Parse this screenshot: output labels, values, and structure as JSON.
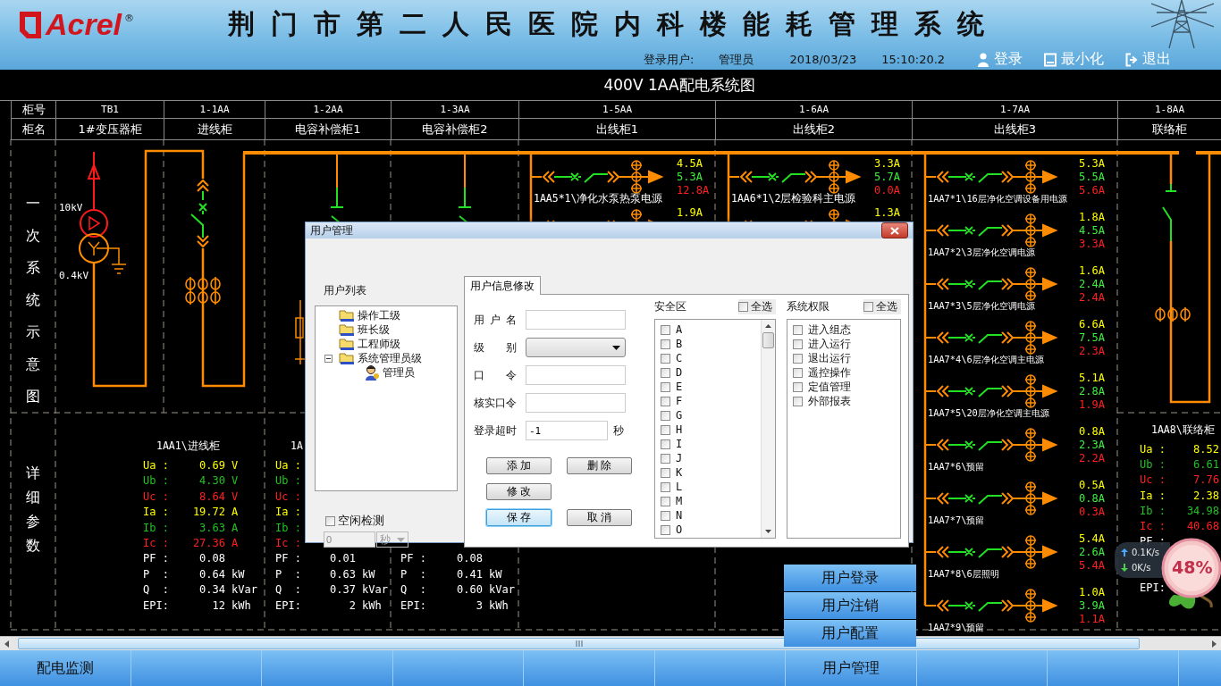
{
  "header": {
    "logo": "Acrel",
    "logo_mark": "®",
    "title": "荆门市第二人民医院内科楼能耗管理系统",
    "login_label": "登录用户:",
    "user": "管理员",
    "date": "2018/03/23",
    "time": "15:10:20.2",
    "actions": [
      {
        "label": "登录"
      },
      {
        "label": "最小化"
      },
      {
        "label": "退出"
      }
    ]
  },
  "diagram_title": "400V 1AA配电系统图",
  "cabinet_table": {
    "number_label": "柜号",
    "name_label": "柜名",
    "cabinets": [
      {
        "number": "TB1",
        "name": "1#变压器柜"
      },
      {
        "number": "1-1AA",
        "name": "进线柜"
      },
      {
        "number": "1-2AA",
        "name": "电容补偿柜1"
      },
      {
        "number": "1-3AA",
        "name": "电容补偿柜2"
      },
      {
        "number": "1-5AA",
        "name": "出线柜1"
      },
      {
        "number": "1-6AA",
        "name": "出线柜2"
      },
      {
        "number": "1-7AA",
        "name": "出线柜3"
      },
      {
        "number": "1-8AA",
        "name": "联络柜"
      }
    ]
  },
  "section_labels": [
    "一次系统示意图",
    "详细参数"
  ],
  "diagram": {
    "voltage_high": "10kV",
    "voltage_low": "0.4kV",
    "feeder_groups": [
      {
        "feeders": [
          {
            "name": "1AA5*1\\净化水泵热泵电源",
            "currents": [
              {
                "value": "4.5A",
                "color": "#ffff00"
              },
              {
                "value": "5.3A",
                "color": "#3cf03c"
              },
              {
                "value": "12.8A",
                "color": "#ff2020"
              }
            ]
          },
          {
            "currents": [
              {
                "value": "1.9A",
                "color": "#ffff00"
              }
            ]
          }
        ]
      },
      {
        "feeders": [
          {
            "name": "1AA6*1\\2层检验科主电源",
            "currents": [
              {
                "value": "3.3A",
                "color": "#ffff00"
              },
              {
                "value": "5.7A",
                "color": "#3cf03c"
              },
              {
                "value": "0.0A",
                "color": "#ff2020"
              }
            ]
          },
          {
            "currents": [
              {
                "value": "1.3A",
                "color": "#ffff00"
              }
            ]
          }
        ]
      },
      {
        "feeders": [
          {
            "name": "1AA7*1\\16层净化空调设备用电源",
            "currents": [
              {
                "value": "5.3A",
                "color": "#ffff00"
              },
              {
                "value": "5.5A",
                "color": "#3cf03c"
              },
              {
                "value": "5.6A",
                "color": "#ff2020"
              }
            ]
          },
          {
            "name": "1AA7*2\\3层净化空调电源",
            "currents": [
              {
                "value": "1.8A",
                "color": "#ffff00"
              },
              {
                "value": "4.5A",
                "color": "#3cf03c"
              },
              {
                "value": "3.3A",
                "color": "#ff2020"
              }
            ]
          },
          {
            "name": "1AA7*3\\5层净化空调电源",
            "currents": [
              {
                "value": "1.6A",
                "color": "#ffff00"
              },
              {
                "value": "2.4A",
                "color": "#3cf03c"
              },
              {
                "value": "2.4A",
                "color": "#ff2020"
              }
            ]
          },
          {
            "name": "1AA7*4\\6层净化空调主电源",
            "currents": [
              {
                "value": "6.6A",
                "color": "#ffff00"
              },
              {
                "value": "7.5A",
                "color": "#3cf03c"
              },
              {
                "value": "2.3A",
                "color": "#ff2020"
              }
            ]
          },
          {
            "name": "1AA7*5\\20层净化空调主电源",
            "currents": [
              {
                "value": "5.1A",
                "color": "#ffff00"
              },
              {
                "value": "2.8A",
                "color": "#3cf03c"
              },
              {
                "value": "1.9A",
                "color": "#ff2020"
              }
            ]
          },
          {
            "name": "1AA7*6\\预留",
            "currents": [
              {
                "value": "0.8A",
                "color": "#ffff00"
              },
              {
                "value": "2.3A",
                "color": "#3cf03c"
              },
              {
                "value": "2.2A",
                "color": "#ff2020"
              }
            ]
          },
          {
            "name": "1AA7*7\\预留",
            "currents": [
              {
                "value": "0.5A",
                "color": "#ffff00"
              },
              {
                "value": "0.8A",
                "color": "#3cf03c"
              },
              {
                "value": "0.3A",
                "color": "#ff2020"
              }
            ]
          },
          {
            "name": "1AA7*8\\6层照明",
            "currents": [
              {
                "value": "5.4A",
                "color": "#ffff00"
              },
              {
                "value": "2.6A",
                "color": "#3cf03c"
              },
              {
                "value": "5.4A",
                "color": "#ff2020"
              }
            ]
          },
          {
            "name": "1AA7*9\\预留",
            "currents": [
              {
                "value": "1.0A",
                "color": "#ffff00"
              },
              {
                "value": "3.9A",
                "color": "#3cf03c"
              },
              {
                "value": "1.1A",
                "color": "#ff2020"
              }
            ]
          }
        ]
      }
    ]
  },
  "params": [
    {
      "title": "1AA1\\进线柜",
      "rows": [
        {
          "label": "Ua :",
          "value": "0.69",
          "unit": "V",
          "color": "#ffff00"
        },
        {
          "label": "Ub :",
          "value": "4.30",
          "unit": "V",
          "color": "#22c022"
        },
        {
          "label": "Uc :",
          "value": "8.64",
          "unit": "V",
          "color": "#ff2020"
        },
        {
          "label": "Ia :",
          "value": "19.72",
          "unit": "A",
          "color": "#ffff00"
        },
        {
          "label": "Ib :",
          "value": "3.63",
          "unit": "A",
          "color": "#22c022"
        },
        {
          "label": "Ic :",
          "value": "27.36",
          "unit": "A",
          "color": "#ff2020"
        },
        {
          "label": "PF :",
          "value": "0.08",
          "color": "#ffffff"
        },
        {
          "label": "P  :",
          "value": "0.64",
          "unit": "kW",
          "color": "#ffffff"
        },
        {
          "label": "Q  :",
          "value": "0.34",
          "unit": "kVar",
          "color": "#ffffff"
        },
        {
          "label": "EPI:",
          "value": "12",
          "unit": "kWh",
          "color": "#ffffff"
        }
      ]
    },
    {
      "title": "1A",
      "rows": [
        {
          "label": "Ua :",
          "color": "#ffff00"
        },
        {
          "label": "Ub :",
          "color": "#22c022"
        },
        {
          "label": "Uc :",
          "color": "#ff2020"
        },
        {
          "label": "Ia :",
          "color": "#ffff00"
        },
        {
          "label": "Ib :",
          "color": "#22c022"
        },
        {
          "label": "Ic :",
          "color": "#ff2020"
        },
        {
          "label": "PF :",
          "value": "0.01",
          "color": "#ffffff"
        },
        {
          "label": "P  :",
          "value": "0.63",
          "unit": "kW",
          "color": "#ffffff"
        },
        {
          "label": "Q  :",
          "value": "0.37",
          "unit": "kVar",
          "color": "#ffffff"
        },
        {
          "label": "EPI:",
          "value": "2",
          "unit": "kWh",
          "color": "#ffffff"
        }
      ]
    },
    {
      "rows": [
        {
          "label": "PF :",
          "value": "0.08",
          "color": "#ffffff"
        },
        {
          "label": "P  :",
          "value": "0.41",
          "unit": "kW",
          "color": "#ffffff"
        },
        {
          "label": "Q  :",
          "value": "0.60",
          "unit": "kVar",
          "color": "#ffffff"
        },
        {
          "label": "EPI:",
          "value": "3",
          "unit": "kWh",
          "color": "#ffffff"
        }
      ]
    },
    {
      "title": "1AA8\\联络柜",
      "rows": [
        {
          "label": "Ua :",
          "value": "8.52",
          "color": "#ffff00"
        },
        {
          "label": "Ub :",
          "value": "6.61",
          "color": "#22c022"
        },
        {
          "label": "Uc :",
          "value": "7.76",
          "color": "#ff2020"
        },
        {
          "label": "Ia :",
          "value": "2.38",
          "color": "#ffff00"
        },
        {
          "label": "Ib :",
          "value": "34.98",
          "color": "#22c022"
        },
        {
          "label": "Ic :",
          "value": "40.68",
          "color": "#ff2020"
        },
        {
          "label": "PF :",
          "color": "#ffffff"
        },
        {
          "label": "EPI:",
          "color": "#ffffff"
        }
      ]
    }
  ],
  "nav_tabs": [
    {
      "label": "配电监测"
    },
    {
      "label": "用户管理"
    }
  ],
  "popup_menu": [
    "用户登录",
    "用户注销",
    "用户配置"
  ],
  "net_widget": {
    "upload": "0.1K/s",
    "download": "0K/s",
    "percent": "48%"
  },
  "dialog": {
    "title": "用户管理",
    "user_list_label": "用户列表",
    "tree": [
      {
        "label": "操作工级",
        "expanded": false
      },
      {
        "label": "班长级",
        "expanded": false
      },
      {
        "label": "工程师级",
        "expanded": false
      },
      {
        "label": "系统管理员级",
        "expanded": true,
        "children": [
          {
            "label": "管理员"
          }
        ]
      }
    ],
    "idle_check": {
      "label": "空闲检测",
      "checked": false,
      "value": "0",
      "unit": "秒",
      "disabled": true
    },
    "tabs": [
      {
        "label": "用户信息修改",
        "selected": true
      }
    ],
    "fields": [
      {
        "label": "用 户 名",
        "kind": "text"
      },
      {
        "label": "级 别",
        "kind": "select"
      },
      {
        "label": "口 令",
        "kind": "text"
      },
      {
        "label": "核实口令",
        "kind": "text"
      },
      {
        "label": "登录超时",
        "kind": "text",
        "value": "-1",
        "unit": "秒"
      }
    ],
    "button_rows": [
      [
        {
          "label": "添 加",
          "focused": false
        },
        {
          "label": "删 除",
          "focused": false
        }
      ],
      [
        {
          "label": "修 改",
          "focused": false
        }
      ],
      [
        {
          "label": "保 存",
          "focused": true
        },
        {
          "label": "取 消",
          "focused": false
        }
      ]
    ],
    "security_zone": {
      "label": "安全区",
      "select_all": {
        "label": "全选",
        "checked": false
      },
      "items": [
        {
          "label": "A",
          "checked": false
        },
        {
          "label": "B",
          "checked": false
        },
        {
          "label": "C",
          "checked": false
        },
        {
          "label": "D",
          "checked": false
        },
        {
          "label": "E",
          "checked": false
        },
        {
          "label": "F",
          "checked": false
        },
        {
          "label": "G",
          "checked": false
        },
        {
          "label": "H",
          "checked": false
        },
        {
          "label": "I",
          "checked": false
        },
        {
          "label": "J",
          "checked": false
        },
        {
          "label": "K",
          "checked": false
        },
        {
          "label": "L",
          "checked": false
        },
        {
          "label": "M",
          "checked": false
        },
        {
          "label": "N",
          "checked": false
        },
        {
          "label": "O",
          "checked": false
        }
      ]
    },
    "permissions": {
      "label": "系统权限",
      "select_all": {
        "label": "全选",
        "checked": false
      },
      "items": [
        {
          "label": "进入组态",
          "checked": false
        },
        {
          "label": "进入运行",
          "checked": false
        },
        {
          "label": "退出运行",
          "checked": false
        },
        {
          "label": "遥控操作",
          "checked": false
        },
        {
          "label": "定值管理",
          "checked": false
        },
        {
          "label": "外部报表",
          "checked": false
        }
      ]
    }
  }
}
